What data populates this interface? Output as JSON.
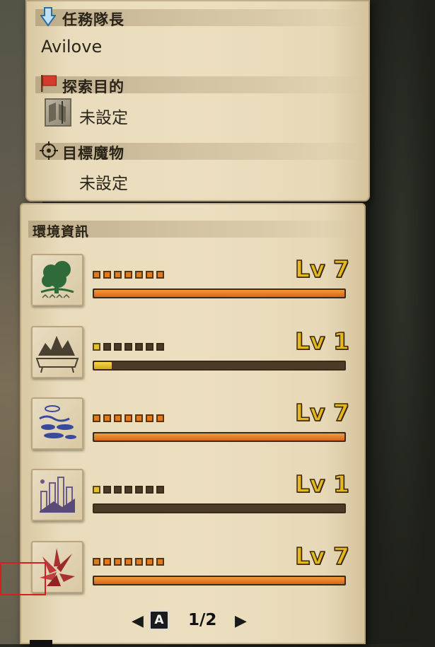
{
  "quest_info": {
    "leader": {
      "label": "任務隊長",
      "value": "Avilove",
      "icon": "down-arrow-icon"
    },
    "objective": {
      "label": "探索目的",
      "value": "未設定",
      "icon": "red-flag-icon",
      "value_icon": "expedition-icon"
    },
    "target": {
      "label": "目標魔物",
      "value": "未設定",
      "icon": "crosshair-icon"
    }
  },
  "environment": {
    "title": "環境資訊",
    "rows": [
      {
        "icon": "forest-tree-icon",
        "level_label": "Lv 7",
        "level": 7,
        "max": 7,
        "color": "#e07a1a",
        "bar_fraction": 1.0
      },
      {
        "icon": "wildspire-plateau-icon",
        "level_label": "Lv 1",
        "level": 1,
        "max": 7,
        "color": "#e6c21c",
        "bar_fraction": 0.07
      },
      {
        "icon": "coral-highlands-icon",
        "level_label": "Lv 7",
        "level": 7,
        "max": 7,
        "color": "#e07a1a",
        "bar_fraction": 1.0
      },
      {
        "icon": "rotten-vale-icon",
        "level_label": "Lv 1",
        "level": 1,
        "max": 7,
        "color": "#e6c21c",
        "bar_fraction": 0.0
      },
      {
        "icon": "elders-recess-crystal-icon",
        "level_label": "Lv 7",
        "level": 7,
        "max": 7,
        "color": "#e07a1a",
        "bar_fraction": 1.0
      }
    ]
  },
  "pager": {
    "key": "A",
    "page_text": "1/2"
  }
}
